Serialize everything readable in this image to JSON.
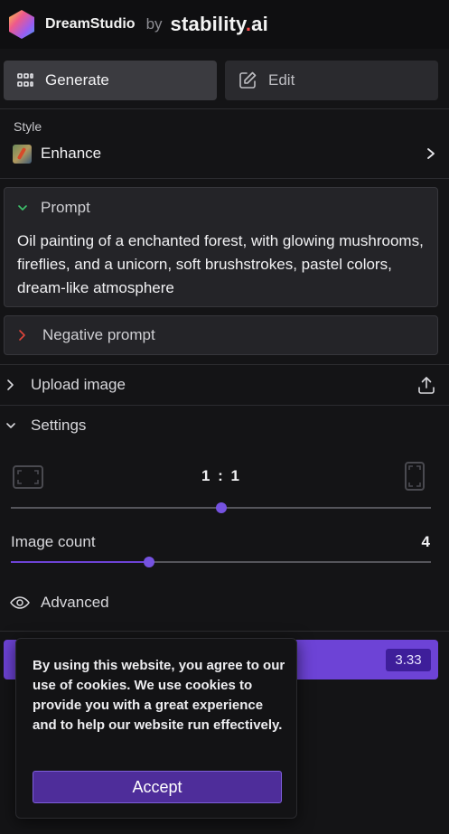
{
  "header": {
    "app_name": "DreamStudio",
    "by": "by",
    "company_main": "stability",
    "company_dot": ".",
    "company_suffix": "ai"
  },
  "tabs": [
    {
      "label": "Generate",
      "icon": "grid-icon",
      "active": true
    },
    {
      "label": "Edit",
      "icon": "pencil-square-icon",
      "active": false
    }
  ],
  "style": {
    "label": "Style",
    "value": "Enhance"
  },
  "prompt": {
    "heading": "Prompt",
    "text": "Oil painting of a enchanted forest, with glowing mushrooms, fireflies, and a unicorn, soft brushstrokes, pastel colors, dream-like atmosphere"
  },
  "negative_prompt": {
    "heading": "Negative prompt"
  },
  "upload": {
    "label": "Upload image"
  },
  "settings": {
    "heading": "Settings",
    "aspect_ratio": "1 : 1",
    "aspect_ratio_position": 0.5,
    "image_count_label": "Image count",
    "image_count": "4",
    "image_count_position": 0.33
  },
  "advanced": {
    "label": "Advanced"
  },
  "dream_button": {
    "cost": "3.33"
  },
  "cookie_banner": {
    "text": "By using this website, you agree to our use of cookies. We use cookies to provide you with a great experience and to help our website run effectively.",
    "accept_label": "Accept"
  },
  "colors": {
    "accent": "#6d43d6",
    "background": "#141416",
    "negative_chevron": "#e0453a",
    "prompt_chevron": "#3ec46d"
  }
}
